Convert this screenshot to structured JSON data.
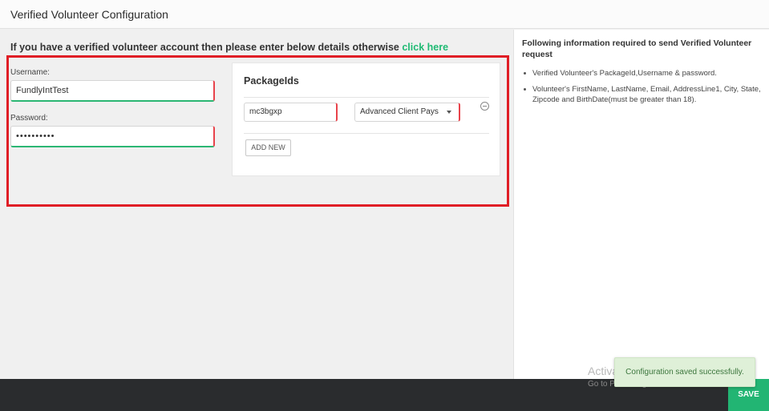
{
  "header": {
    "title": "Verified Volunteer Configuration"
  },
  "intro": {
    "text": "If you have a verified volunteer account then please enter below details otherwise ",
    "link": "click here"
  },
  "credentials": {
    "username_label": "Username:",
    "username_value": "FundlyIntTest",
    "password_label": "Password:",
    "password_value": "••••••••••"
  },
  "packages": {
    "title": "PackageIds",
    "items": [
      {
        "id": "mc3bgxp",
        "payment": "Advanced Client Pays"
      }
    ],
    "add_label": "ADD NEW"
  },
  "info": {
    "title": "Following information required to send Verified Volunteer request",
    "bullets": [
      "Verified Volunteer's PackageId,Username & password.",
      "Volunteer's FirstName, LastName, Email, AddressLine1, City, State, Zipcode and BirthDate(must be greater than 18)."
    ]
  },
  "footer": {
    "save_label": "SAVE"
  },
  "toast": {
    "message": "Configuration saved successfully."
  },
  "watermark": {
    "line1": "Activate Windows",
    "line2": "Go to PC settings to activate Windows."
  },
  "colors": {
    "accent_green": "#22b573",
    "highlight_red": "#e01e26",
    "footer_dark": "#2a2c2e"
  }
}
